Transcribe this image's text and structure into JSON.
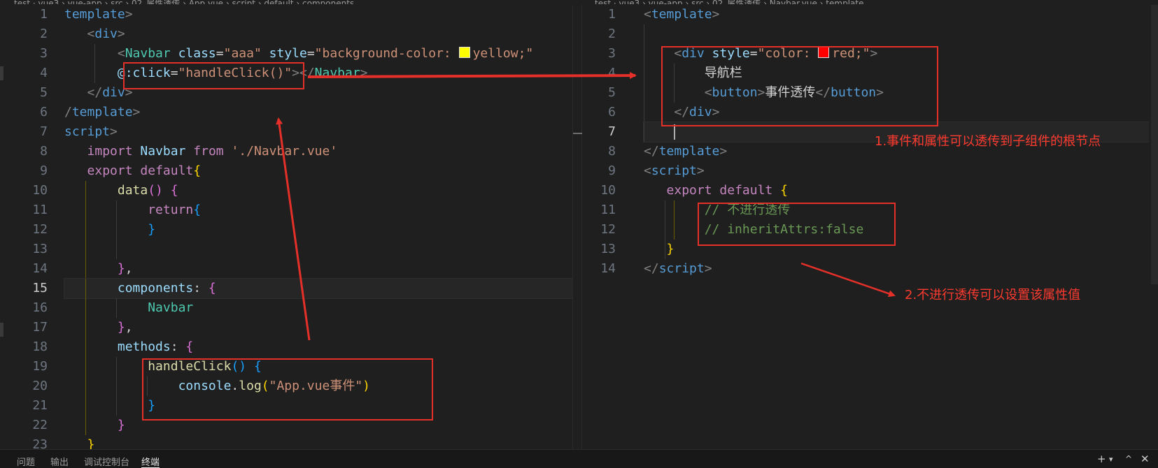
{
  "breadcrumbs": {
    "left": "test · vue3 › vue-app › src › 02_属性透传 › App.vue › script › default › components",
    "right": "test · vue3 › vue-app › src › 02_属性透传 › Navbar.vue › template"
  },
  "left_editor": {
    "line_numbers": [
      "1",
      "2",
      "3",
      "4",
      "5",
      "6",
      "7",
      "8",
      "9",
      "10",
      "11",
      "12",
      "13",
      "14",
      "15",
      "16",
      "17",
      "18",
      "19",
      "20",
      "21",
      "22",
      "23"
    ],
    "active_line": "15",
    "swatch_color": "#ffff00",
    "lines": [
      [
        "template",
        ">"
      ],
      [
        "<",
        "div",
        ">"
      ],
      [
        "<",
        "Navbar",
        " ",
        "class",
        "=",
        "\"aaa\"",
        " ",
        "style",
        "=",
        "\"background-color: ",
        "yellow;\""
      ],
      [
        "@:click",
        "=",
        "\"handleClick()\"",
        "></",
        "Navbar",
        ">"
      ],
      [
        "</",
        "div",
        ">"
      ],
      [
        "/",
        "template",
        ">"
      ],
      [
        "script",
        ">"
      ],
      [
        "import",
        " ",
        "Navbar",
        " ",
        "from",
        " ",
        "'./Navbar.vue'"
      ],
      [
        "export",
        " ",
        "default",
        "{"
      ],
      [
        "data",
        "()",
        " ",
        "{"
      ],
      [
        "return",
        "{"
      ],
      [
        "}"
      ],
      [],
      [
        "}",
        ","
      ],
      [
        "components",
        ":",
        " ",
        "{"
      ],
      [
        "Navbar"
      ],
      [
        "}",
        ","
      ],
      [
        "methods",
        ":",
        " ",
        "{"
      ],
      [
        "handleClick",
        "()",
        " ",
        "{"
      ],
      [
        "console",
        ".",
        "log",
        "(",
        "\"App.vue事件\"",
        ")"
      ],
      [
        "}"
      ],
      [
        "}"
      ],
      [
        "}"
      ]
    ]
  },
  "right_editor": {
    "line_numbers": [
      "1",
      "2",
      "3",
      "4",
      "5",
      "6",
      "7",
      "8",
      "9",
      "10",
      "11",
      "12",
      "13",
      "14"
    ],
    "active_line": "7",
    "swatch_color": "#ff0000",
    "lines": [
      [
        "<",
        "template",
        ">"
      ],
      [],
      [
        "<",
        "div",
        " ",
        "style",
        "=",
        "\"color: ",
        "red;\"",
        ">"
      ],
      [
        "导航栏"
      ],
      [
        "<",
        "button",
        ">",
        "事件透传",
        "</",
        "button",
        ">"
      ],
      [
        "</",
        "div",
        ">"
      ],
      [],
      [
        "</",
        "template",
        ">"
      ],
      [
        "<",
        "script",
        ">"
      ],
      [
        "export",
        " ",
        "default",
        " ",
        "{"
      ],
      [
        "// 不进行透传"
      ],
      [
        "// inheritAttrs:false"
      ],
      [
        "}"
      ],
      [
        "</",
        "script",
        ">"
      ]
    ]
  },
  "annotations": {
    "note1": "1.事件和属性可以透传到子组件的根节点",
    "note2": "2.不进行透传可以设置该属性值",
    "color": "#e5302a"
  },
  "panel": {
    "tabs": [
      "问题",
      "输出",
      "调试控制台",
      "终端"
    ],
    "active_tab": "终端",
    "icons": [
      "plus-icon",
      "chevron-down-icon",
      "maximize-icon",
      "close-icon"
    ]
  }
}
